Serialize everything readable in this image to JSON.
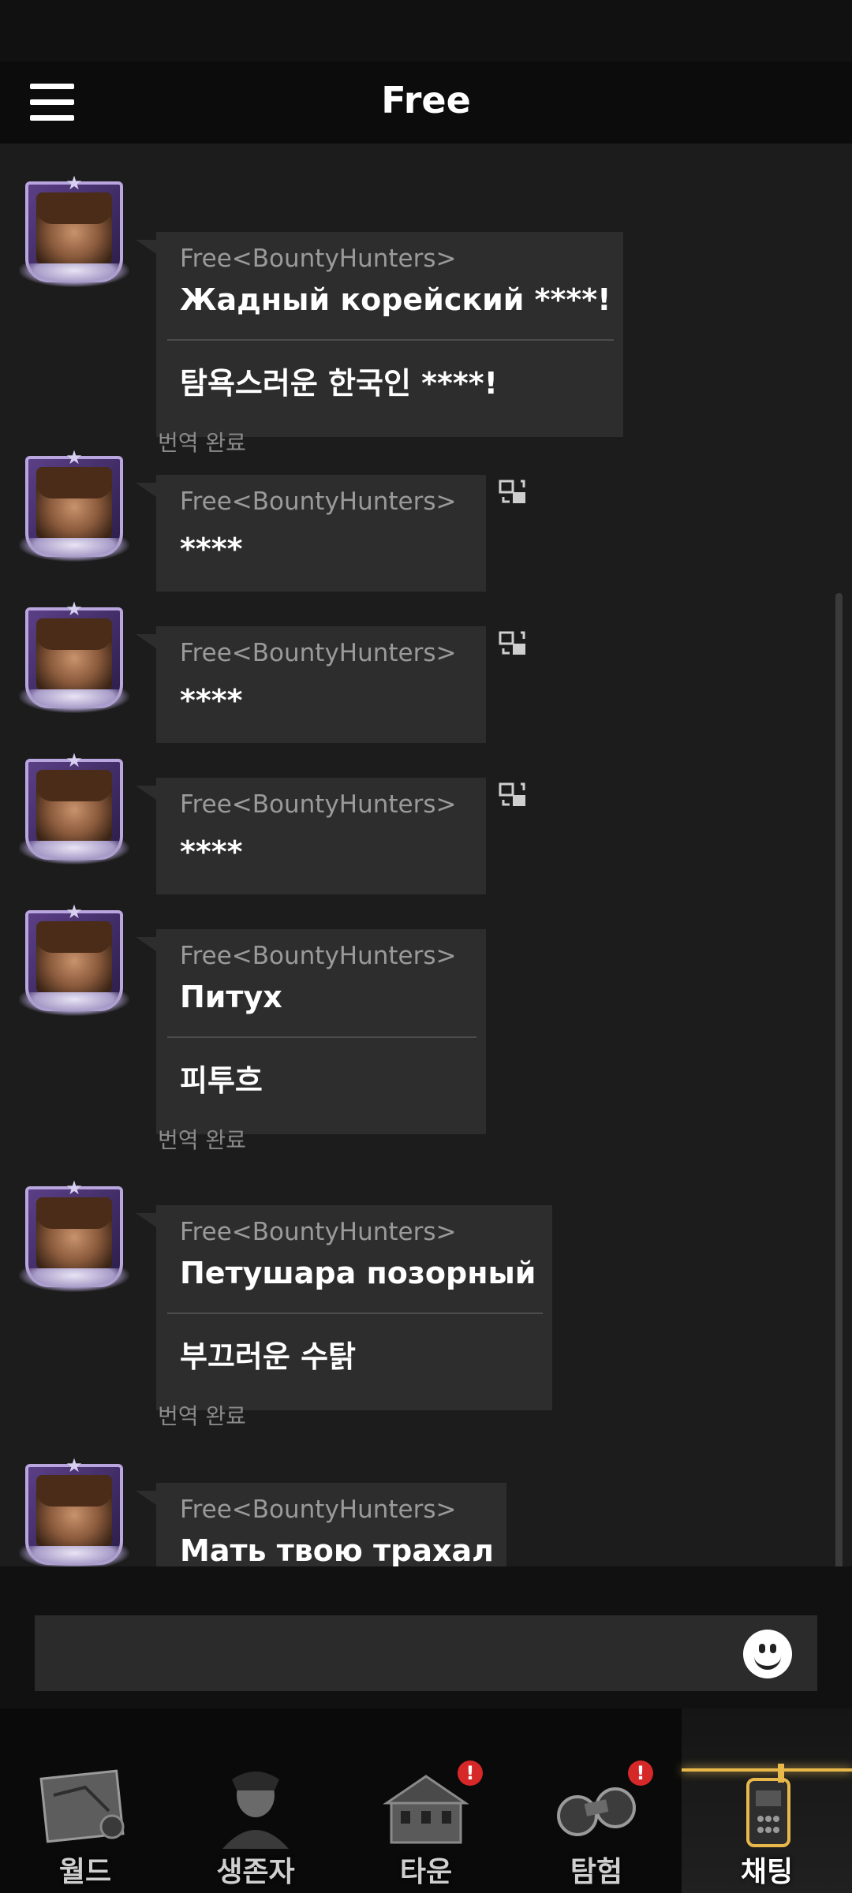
{
  "header": {
    "title": "Free"
  },
  "messages": [
    {
      "sender": "Free<BountyHunters>",
      "text": "Жадный корейский ****!",
      "translation": "탐욕스러운 한국인 ****!",
      "status": "번역 완료"
    },
    {
      "sender": "Free<BountyHunters>",
      "text": "****"
    },
    {
      "sender": "Free<BountyHunters>",
      "text": "****"
    },
    {
      "sender": "Free<BountyHunters>",
      "text": "****"
    },
    {
      "sender": "Free<BountyHunters>",
      "text": "Питух",
      "translation": "피투흐",
      "status": "번역 완료"
    },
    {
      "sender": "Free<BountyHunters>",
      "text": "Петушара позорный",
      "translation": "부끄러운 수탉",
      "status": "번역 완료"
    },
    {
      "sender": "Free<BountyHunters>",
      "text": "Мать твою трахал"
    }
  ],
  "input": {
    "value": "",
    "emoji_icon": "smiley-icon"
  },
  "nav": [
    {
      "label": "월드",
      "icon": "world-map-icon",
      "badge": ""
    },
    {
      "label": "생존자",
      "icon": "survivor-icon",
      "badge": ""
    },
    {
      "label": "타운",
      "icon": "town-icon",
      "badge": "!"
    },
    {
      "label": "탐험",
      "icon": "binoculars-icon",
      "badge": "!"
    },
    {
      "label": "채팅",
      "icon": "radio-icon",
      "badge": ""
    }
  ],
  "colors": {
    "accent": "#e8b84a",
    "badge": "#d62828",
    "bubble": "#2d2d2d"
  }
}
